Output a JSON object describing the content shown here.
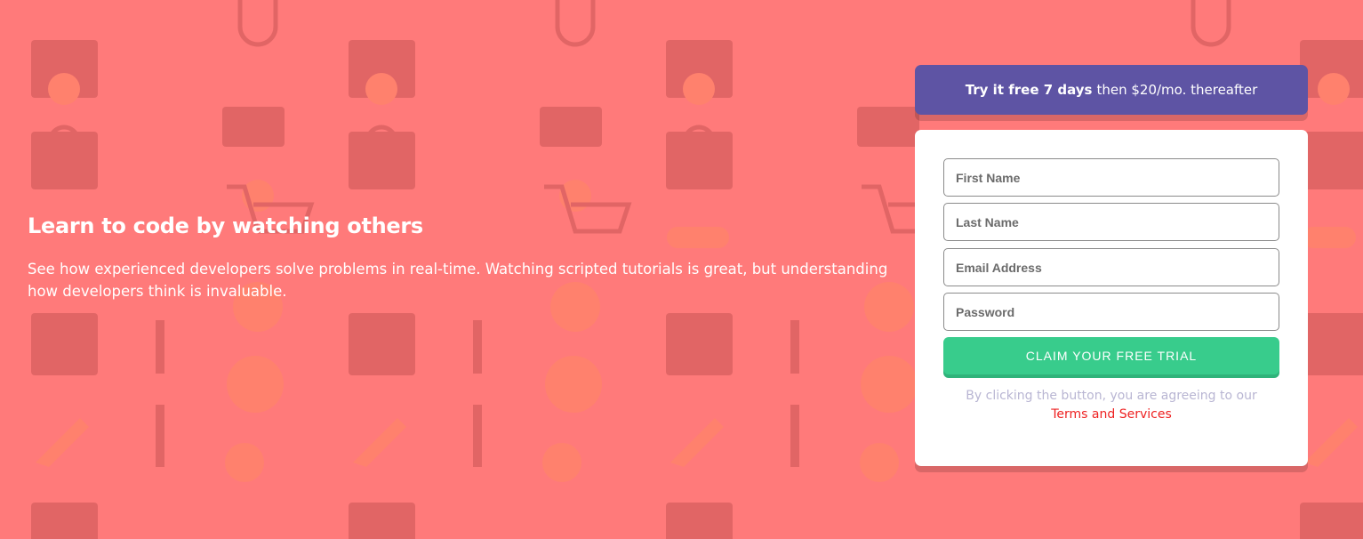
{
  "hero": {
    "title": "Learn to code by watching others",
    "text": "See how experienced developers solve problems in real-time. Watching scripted tutorials is great, but understanding how developers think is invaluable."
  },
  "promo": {
    "bold": "Try it free 7 days",
    "rest": "then $20/mo. thereafter"
  },
  "form": {
    "first_name_placeholder": "First Name",
    "last_name_placeholder": "Last Name",
    "email_placeholder": "Email Address",
    "password_placeholder": "Password",
    "submit_label": "CLAIM YOUR FREE TRIAL",
    "terms_text": "By clicking the button, you are agreeing to our",
    "terms_link": "Terms and Services"
  },
  "colors": {
    "background": "#ff7a7a",
    "promo": "#5e54a4",
    "cta": "#38cc8c",
    "terms_link": "#ff0000"
  }
}
